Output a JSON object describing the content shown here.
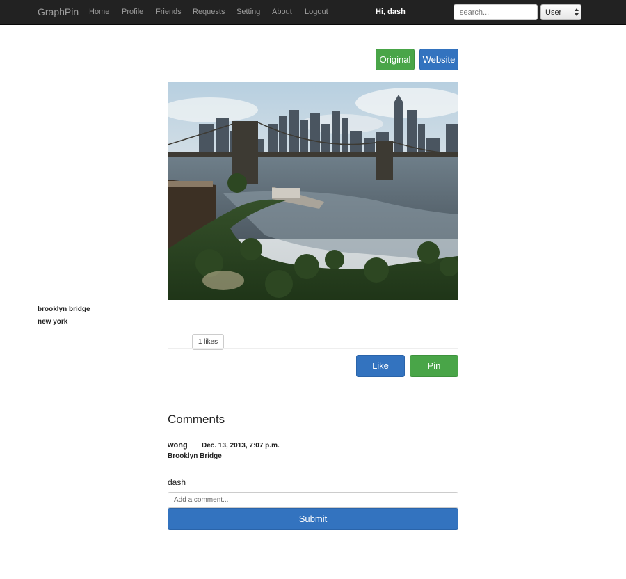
{
  "navbar": {
    "brand": "GraphPin",
    "links": [
      "Home",
      "Profile",
      "Friends",
      "Requests",
      "Setting",
      "About",
      "Logout"
    ],
    "greeting": "Hi, dash",
    "search_placeholder": "search...",
    "select_value": "User"
  },
  "actions": {
    "original_label": "Original",
    "website_label": "Website"
  },
  "pin": {
    "tags": [
      "brooklyn bridge",
      "new york"
    ],
    "likes_label": "1 likes",
    "like_label": "Like",
    "pin_label": "Pin"
  },
  "comments": {
    "heading": "Comments",
    "items": [
      {
        "author": "wong",
        "date": "Dec. 13, 2013, 7:07 p.m.",
        "text": "Brooklyn Bridge"
      }
    ],
    "current_user": "dash",
    "input_placeholder": "Add a comment...",
    "submit_label": "Submit"
  },
  "colors": {
    "navbar_bg": "#222222",
    "success": "#49a548",
    "primary": "#3373bf"
  }
}
